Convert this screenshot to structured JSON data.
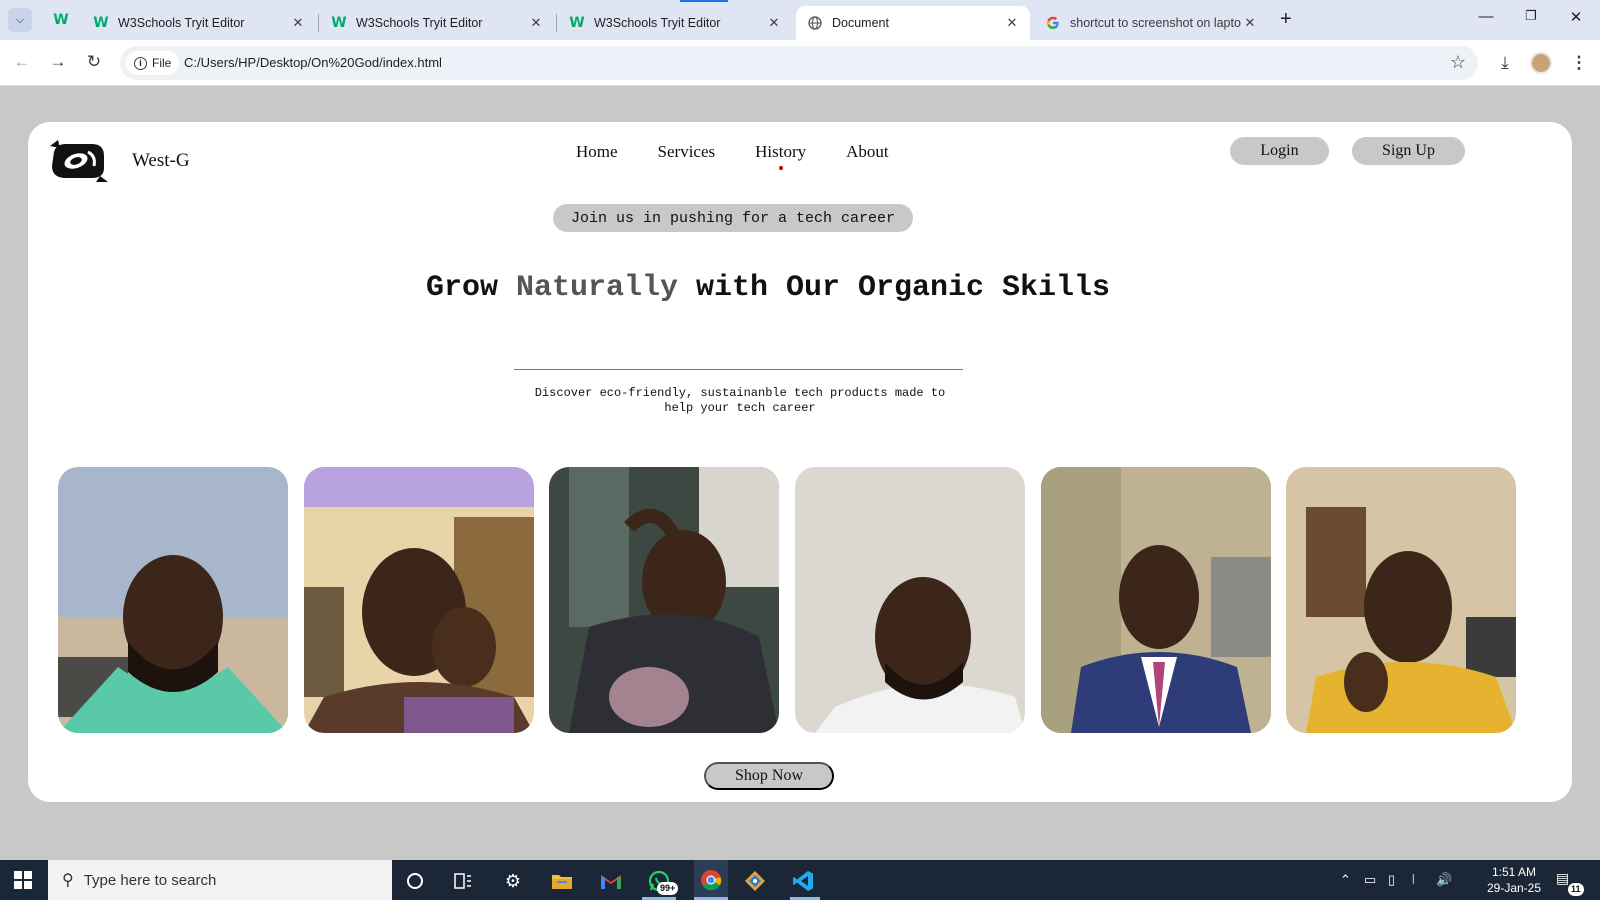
{
  "browser": {
    "tabs": [
      {
        "title": "W3Schools Tryit Editor",
        "favicon": "w3schools-icon"
      },
      {
        "title": "W3Schools Tryit Editor",
        "favicon": "w3schools-icon"
      },
      {
        "title": "W3Schools Tryit Editor",
        "favicon": "w3schools-icon"
      },
      {
        "title": "Document",
        "favicon": "globe-icon",
        "active": true
      },
      {
        "title": "shortcut to screenshot on lapto",
        "favicon": "google-icon"
      }
    ],
    "address_chip": "File",
    "url": "C:/Users/HP/Desktop/On%20God/index.html"
  },
  "site": {
    "brand": "West-G",
    "nav": [
      "Home",
      "Services",
      "History",
      "About"
    ],
    "current_nav": "History",
    "login": "Login",
    "signup": "Sign Up",
    "tagline": "Join us in pushing for a tech career",
    "headline_part1": "Grow ",
    "headline_accent": "Naturally",
    "headline_part2": " with Our Organic Skills",
    "subtext": "Discover eco-friendly, sustainanble tech products made to help your tech career",
    "cta": "Shop Now",
    "photo_count": 6
  },
  "taskbar": {
    "search_placeholder": "Type here to search",
    "whatsapp_badge": "99+",
    "time": "1:51 AM",
    "date": "29-Jan-25",
    "notification_count": "11"
  },
  "colors": {
    "page_background": "#c8c8c8",
    "pill_background": "#c8c8c8",
    "accent_word": "#555555",
    "active_nav_dot": "#d00000",
    "taskbar": "#1b2736"
  }
}
